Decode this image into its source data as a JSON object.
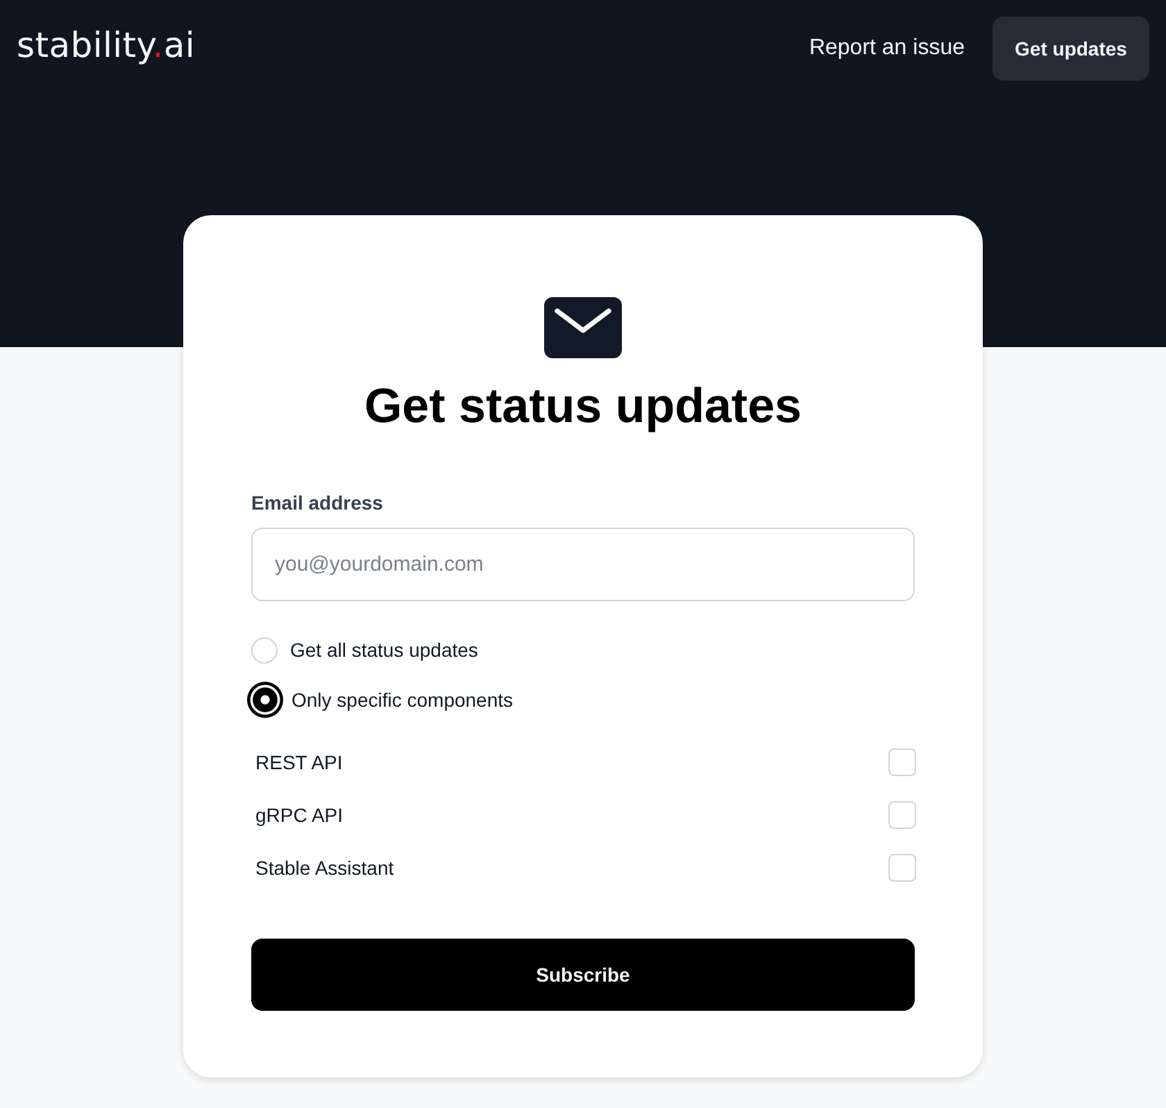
{
  "header": {
    "logo": {
      "name": "stability",
      "dot": ".",
      "suffix": "ai"
    },
    "nav": [
      {
        "label": "Report an issue",
        "kind": "link"
      },
      {
        "label": "Get updates",
        "kind": "button"
      }
    ]
  },
  "card": {
    "title": "Get status updates",
    "email": {
      "label": "Email address",
      "placeholder": "you@yourdomain.com"
    },
    "options": [
      {
        "label": "Get all status updates",
        "selected": false
      },
      {
        "label": "Only specific components",
        "selected": true
      }
    ],
    "components": [
      {
        "name": "REST API",
        "checked": false
      },
      {
        "name": "gRPC API",
        "checked": false
      },
      {
        "name": "Stable Assistant",
        "checked": false
      }
    ],
    "submit": "Subscribe"
  }
}
